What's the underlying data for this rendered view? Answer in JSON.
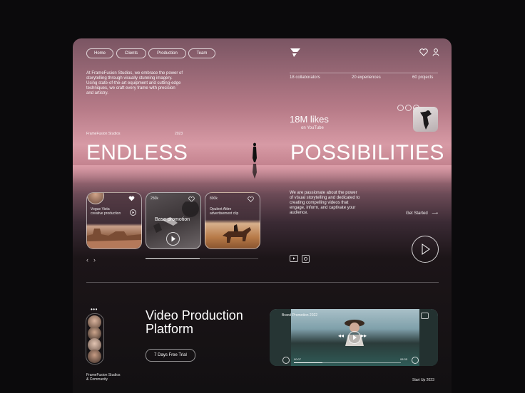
{
  "nav": {
    "items": [
      {
        "label": "Home"
      },
      {
        "label": "Clients"
      },
      {
        "label": "Production"
      },
      {
        "label": "Team"
      }
    ]
  },
  "intro": "At FrameFusion Studios, we embrace the power of storytelling through visually stunning imagery. Using state-of-the-art equipment and cutting-edge techniques, we craft every frame with precision and artistry.",
  "stats": [
    {
      "label": "18 collaborators"
    },
    {
      "label": "20 experiences"
    },
    {
      "label": "60 projects"
    }
  ],
  "likes": {
    "value": "18M likes",
    "source": "on YouTube"
  },
  "studio": {
    "name": "FrameFusion Studios",
    "year": "2023"
  },
  "hero": {
    "left": "ENDLESS",
    "right": "POSSIBILITIES"
  },
  "cards": [
    {
      "title": "Vogue Vista\ncreative production"
    },
    {
      "count": "250k",
      "title": "Base promotion"
    },
    {
      "count": "800k",
      "title": "Opulent Attire\nadvertisement clip"
    }
  ],
  "about": "We are passionate about the power of visual storytelling and dedicated to creating compelling videos that engage, inform, and captivate your audience.",
  "cta": "Get Started",
  "platform": {
    "title_line1": "Video Production",
    "title_line2": "Platform",
    "trial": "7 Days Free Trial"
  },
  "community": "FrameFusion Studios\n& Community",
  "video": {
    "label": "Brand Promotion 2022",
    "time_start": "00:07",
    "time_end": "08:35"
  },
  "footer_right": "Start Up 2023",
  "colors": {
    "accent": "#d79aa5",
    "background": "#0b0a0c"
  }
}
